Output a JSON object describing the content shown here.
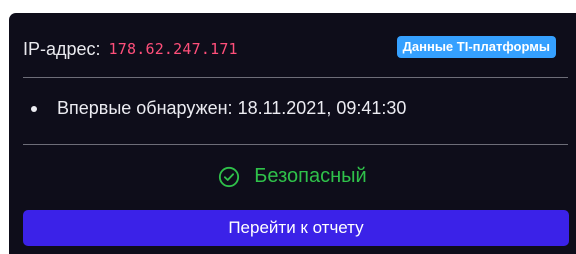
{
  "ip": {
    "label": "IP-адрес:",
    "value": "178.62.247.171"
  },
  "badge": {
    "label": "Данные TI-платформы"
  },
  "details": {
    "first_seen": "Впервые обнаружен: 18.11.2021, 09:41:30"
  },
  "status": {
    "icon": "check-circle-icon",
    "label": "Безопасный",
    "color": "#2fc14a"
  },
  "actions": {
    "report_button": "Перейти к отчету"
  },
  "colors": {
    "card_background": "#0e0d1a",
    "ip_value": "#ff4f7a",
    "badge_background": "#35a0ff",
    "button_background": "#3b22e8"
  }
}
